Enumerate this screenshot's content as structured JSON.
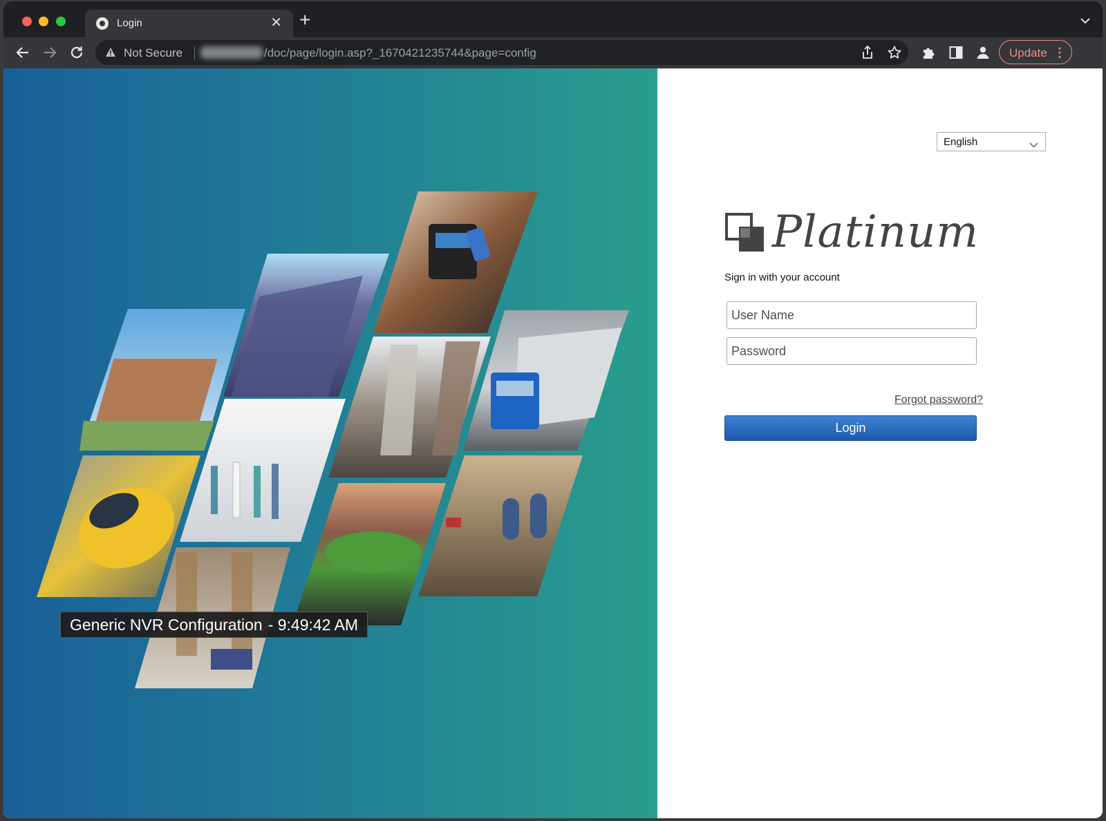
{
  "browser": {
    "tab": {
      "title": "Login"
    },
    "address_bar": {
      "security_label": "Not Secure",
      "url_path": "/doc/page/login.asp?_1670421235744&page=config"
    },
    "update_label": "Update",
    "icons": [
      "back-icon",
      "forward-icon",
      "reload-icon",
      "warning-icon",
      "share-icon",
      "bookmark-star-icon",
      "extensions-puzzle-icon",
      "side-panel-icon",
      "profile-icon",
      "more-icon"
    ]
  },
  "hero": {
    "caption": "Generic NVR Configuration",
    "caption_time": "- 9:49:42 AM",
    "colors": {
      "gradient_start": "#1a5f98",
      "gradient_end": "#2a9d8d"
    }
  },
  "login": {
    "language": "English",
    "brand_name": "Platinum",
    "signin_text": "Sign in with your account",
    "username_placeholder": "User Name",
    "password_placeholder": "Password",
    "forgot_label": "Forgot password?",
    "login_label": "Login",
    "colors": {
      "login_button": "#2767b9"
    }
  }
}
